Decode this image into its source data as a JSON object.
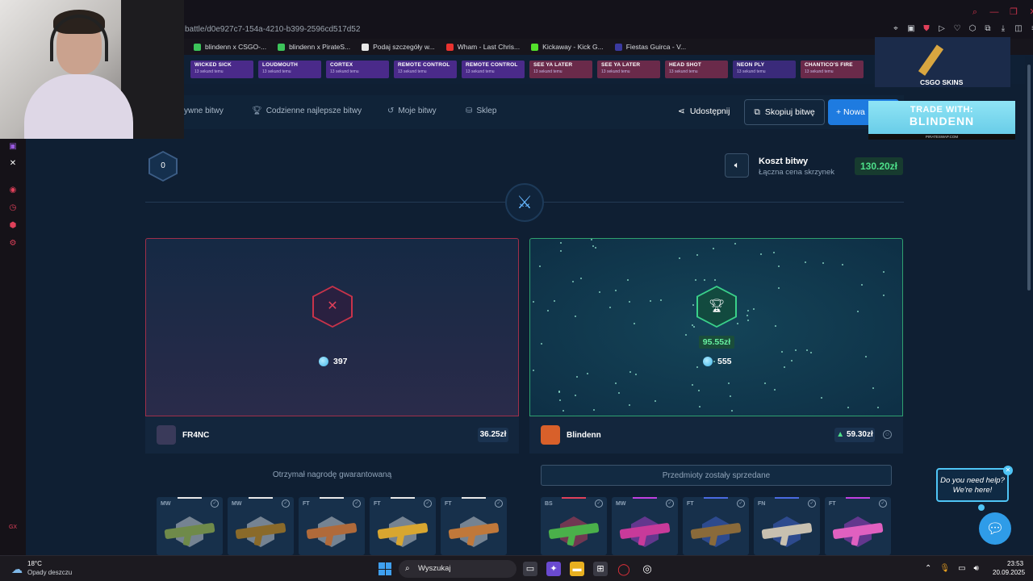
{
  "browser": {
    "url": "battle/d0e927c7-154a-4210-b399-2596cd517d52",
    "bookmarks": [
      {
        "label": "blindenn x CSGO-...",
        "color": "#3cc45a"
      },
      {
        "label": "blindenn x PirateS...",
        "color": "#3cc45a"
      },
      {
        "label": "Podaj szczegóły w...",
        "color": "#e8e8e8"
      },
      {
        "label": "Wham - Last Chris...",
        "color": "#e8322f"
      },
      {
        "label": "Kickaway - Kick G...",
        "color": "#53e02b"
      },
      {
        "label": "Fiestas Guirca - V...",
        "color": "#3a3aa0"
      }
    ]
  },
  "live_drops": [
    {
      "name": "WICKED SICK",
      "time": "13 sekund temu",
      "color": "#4a2a8a"
    },
    {
      "name": "LOUDMOUTH",
      "time": "13 sekund temu",
      "color": "#4a2a8a"
    },
    {
      "name": "CORTEX",
      "time": "13 sekund temu",
      "color": "#4a2a8a"
    },
    {
      "name": "REMOTE CONTROL",
      "time": "13 sekund temu",
      "color": "#4a2a8a"
    },
    {
      "name": "REMOTE CONTROL",
      "time": "13 sekund temu",
      "color": "#4a2a8a"
    },
    {
      "name": "SEE YA LATER",
      "time": "13 sekund temu",
      "color": "#6a2a4a"
    },
    {
      "name": "SEE YA LATER",
      "time": "13 sekund temu",
      "color": "#6a2a4a"
    },
    {
      "name": "HEAD SHOT",
      "time": "13 sekund temu",
      "color": "#6a2a4a"
    },
    {
      "name": "NEON PLY",
      "time": "13 sekund temu",
      "color": "#3a2a7a"
    },
    {
      "name": "CHANTICO'S FIRE",
      "time": "13 sekund temu",
      "color": "#6a2a4a"
    }
  ],
  "nav": {
    "active_battles": "ywne bitwy",
    "daily_best": "Codzienne najlepsze bitwy",
    "my_battles": "Moje bitwy",
    "shop": "Sklep",
    "share": "Udostępnij",
    "copy_battle": "Skopiuj bitwę",
    "new_battle": "+ Nowa"
  },
  "sponsor": {
    "logo_text": "CSGO SKINS",
    "trade_line1": "TRADE WITH:",
    "trade_line2": "BLINDENN",
    "trade_site": "PIRATESWAP.COM"
  },
  "battle": {
    "round": "0",
    "cost_title": "Koszt bitwy",
    "cost_subtitle": "Łączna cena skrzynek",
    "cost_value": "130.20zł"
  },
  "players": [
    {
      "name": "FR4NC",
      "points": "397",
      "total": "36.25zł",
      "result": "lose",
      "note": "Otrzymał nagrodę gwarantowaną",
      "avatar_color": "#3a3a5a",
      "items": [
        {
          "condition": "MW",
          "gun_color": "#6f8a4a",
          "rarity": "#e8e8e8"
        },
        {
          "condition": "MW",
          "gun_color": "#8a6a2a",
          "rarity": "#e8e8e8"
        },
        {
          "condition": "FT",
          "gun_color": "#b06a3a",
          "rarity": "#e8e8e8"
        },
        {
          "condition": "FT",
          "gun_color": "#d8a630",
          "rarity": "#e8e8e8"
        },
        {
          "condition": "FT",
          "gun_color": "#c0783a",
          "rarity": "#e8e8e8"
        }
      ]
    },
    {
      "name": "Blindenn",
      "points": "555",
      "total": "59.30zł",
      "result": "win",
      "win_amount": "95.55zł",
      "note": "Przedmioty zostały sprzedane",
      "avatar_color": "#d8602a",
      "items": [
        {
          "condition": "BS",
          "gun_color": "#4ab04a",
          "rarity": "#e0405a"
        },
        {
          "condition": "MW",
          "gun_color": "#c83a9a",
          "rarity": "#c040e0"
        },
        {
          "condition": "FT",
          "gun_color": "#8a6a3a",
          "rarity": "#4a6ae0"
        },
        {
          "condition": "FN",
          "gun_color": "#c8c0b0",
          "rarity": "#4a6ae0"
        },
        {
          "condition": "FT",
          "gun_color": "#e060c0",
          "rarity": "#c040e0"
        }
      ]
    }
  ],
  "help": {
    "bubble": "Do you need help? We're here!"
  },
  "taskbar": {
    "temp": "18°C",
    "weather": "Opady deszczu",
    "search": "Wyszukaj",
    "time": "23:53",
    "date": "20.09.2025"
  }
}
